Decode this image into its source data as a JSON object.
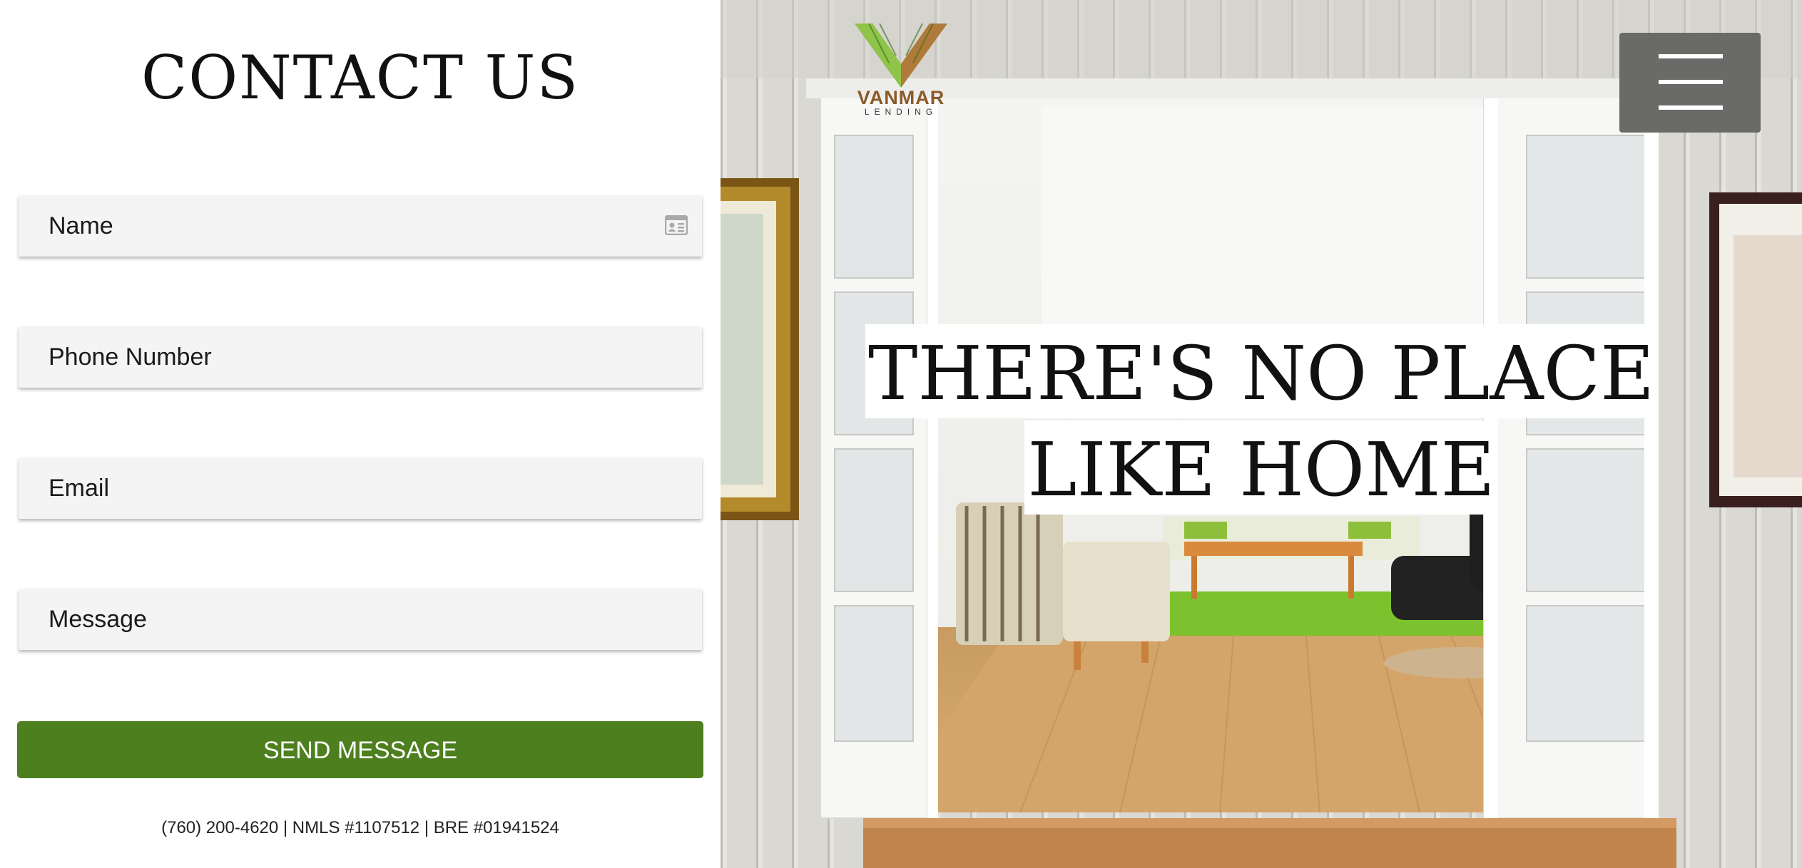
{
  "contact": {
    "title": "CONTACT US",
    "fields": {
      "name": "Name",
      "phone": "Phone Number",
      "email": "Email",
      "message": "Message"
    },
    "submit_label": "SEND MESSAGE",
    "footer": "(760) 200-4620 | NMLS #1107512 | BRE #01941524"
  },
  "hero": {
    "line1": "THERE'S NO PLACE",
    "line2": "LIKE HOME",
    "logo_name": "VANMAR",
    "logo_sub": "LENDING",
    "menu_icon": "hamburger-menu-icon"
  },
  "colors": {
    "accent_green": "#4d7f1f",
    "field_bg": "#f4f4f4",
    "menu_bg": "#6a6a68",
    "logo_bronze": "#8b5a2b"
  }
}
